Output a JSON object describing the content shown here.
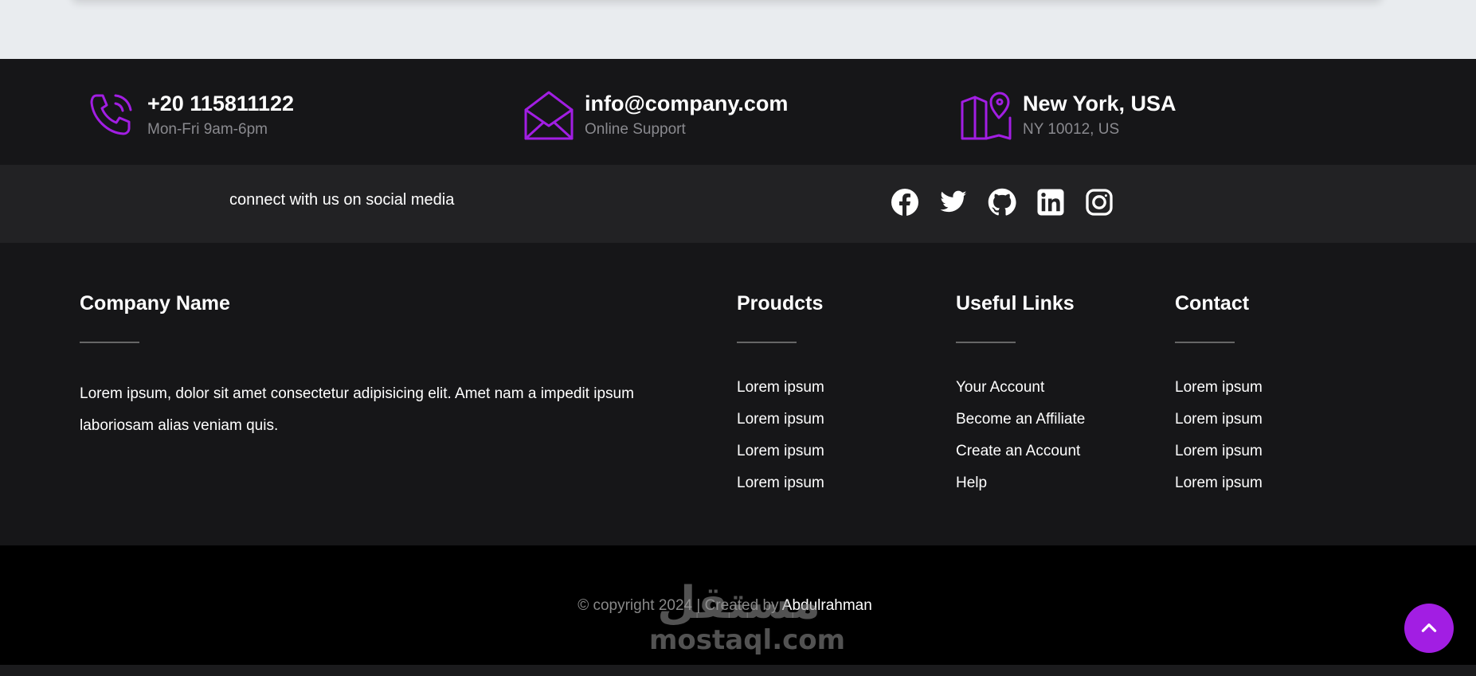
{
  "colors": {
    "accent": "#a21ee3",
    "footer_bg": "#161618",
    "social_bg": "#222224",
    "bottom_bg": "#000000"
  },
  "contacts": [
    {
      "icon": "phone-icon",
      "title": "+20 115811122",
      "subtitle": "Mon-Fri 9am-6pm"
    },
    {
      "icon": "envelope-icon",
      "title": "info@company.com",
      "subtitle": "Online Support"
    },
    {
      "icon": "map-pin-icon",
      "title": "New York, USA",
      "subtitle": "NY 10012, US"
    }
  ],
  "social": {
    "text": "connect with us on social media",
    "icons": [
      "facebook-icon",
      "twitter-icon",
      "github-icon",
      "linkedin-icon",
      "instagram-icon"
    ]
  },
  "footer": {
    "company": {
      "title": "Company Name",
      "text": "Lorem ipsum, dolor sit amet consectetur adipisicing elit. Amet nam a impedit ipsum laboriosam alias veniam quis."
    },
    "products": {
      "title": "Proudcts",
      "items": [
        "Lorem ipsum",
        "Lorem ipsum",
        "Lorem ipsum",
        "Lorem ipsum"
      ]
    },
    "useful_links": {
      "title": "Useful Links",
      "items": [
        "Your Account",
        "Become an Affiliate",
        "Create an Account",
        "Help"
      ]
    },
    "contact": {
      "title": "Contact",
      "items": [
        "Lorem ipsum",
        "Lorem ipsum",
        "Lorem ipsum",
        "Lorem ipsum"
      ]
    }
  },
  "bottom": {
    "copyright": "© copyright 2024 | Created by",
    "author": "Abdulrahman"
  },
  "watermark": {
    "arabic": "مستقل",
    "latin": "mostaql.com"
  },
  "scroll_top": {
    "icon": "chevron-up-icon"
  }
}
